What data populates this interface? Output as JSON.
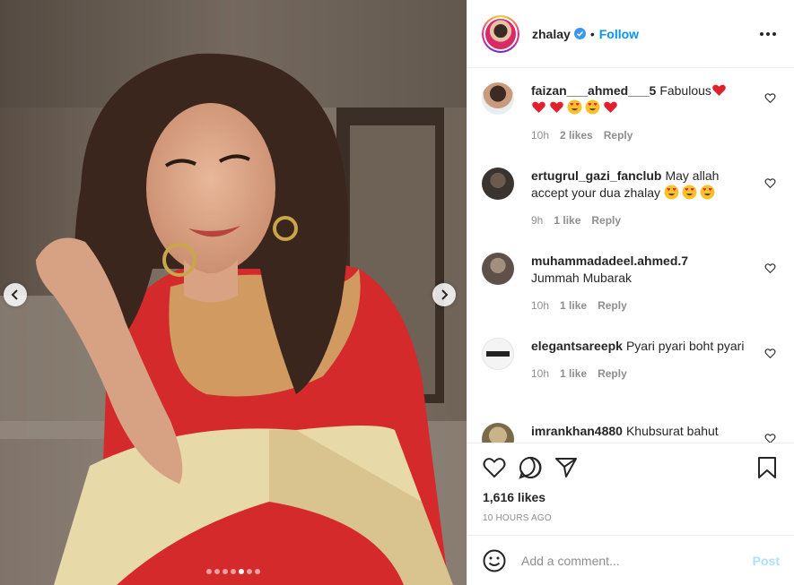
{
  "header": {
    "username": "zhalay",
    "separator": "•",
    "follow_label": "Follow"
  },
  "media": {
    "dots_count": 7,
    "active_dot": 4,
    "prev_icon": "chevron-left-icon",
    "next_icon": "chevron-right-icon"
  },
  "comments": [
    {
      "user": "faizan___ahmed___5",
      "text": "Fabulous",
      "emoji_after_line1": [
        "heart"
      ],
      "emoji_line2": [
        "heart",
        "heart",
        "heart-eyes",
        "heart-eyes",
        "heart"
      ],
      "time": "10h",
      "likes": "2 likes",
      "reply": "Reply"
    },
    {
      "user": "ertugrul_gazi_fanclub",
      "text": "May allah accept your dua zhalay",
      "emoji_after": [
        "heart-eyes",
        "heart-eyes",
        "heart-eyes"
      ],
      "time": "9h",
      "likes": "1 like",
      "reply": "Reply"
    },
    {
      "user": "muhammadadeel.ahmed.7",
      "text": "Jummah Mubarak",
      "time": "10h",
      "likes": "1 like",
      "reply": "Reply"
    },
    {
      "user": "elegantsareepk",
      "text": "Pyari pyari boht pyari",
      "time": "10h",
      "likes": "1 like",
      "reply": "Reply"
    },
    {
      "user": "imrankhan4880",
      "text": "Khubsurat bahut",
      "time": "",
      "likes": "",
      "reply": ""
    }
  ],
  "post": {
    "likes": "1,616 likes",
    "timestamp": "10 HOURS AGO"
  },
  "add_comment": {
    "placeholder": "Add a comment...",
    "post_label": "Post"
  },
  "colors": {
    "accent": "#0095f6",
    "post_disabled": "#b2dffc",
    "muted": "#8e8e8e",
    "dress_red": "#d42a2c"
  }
}
